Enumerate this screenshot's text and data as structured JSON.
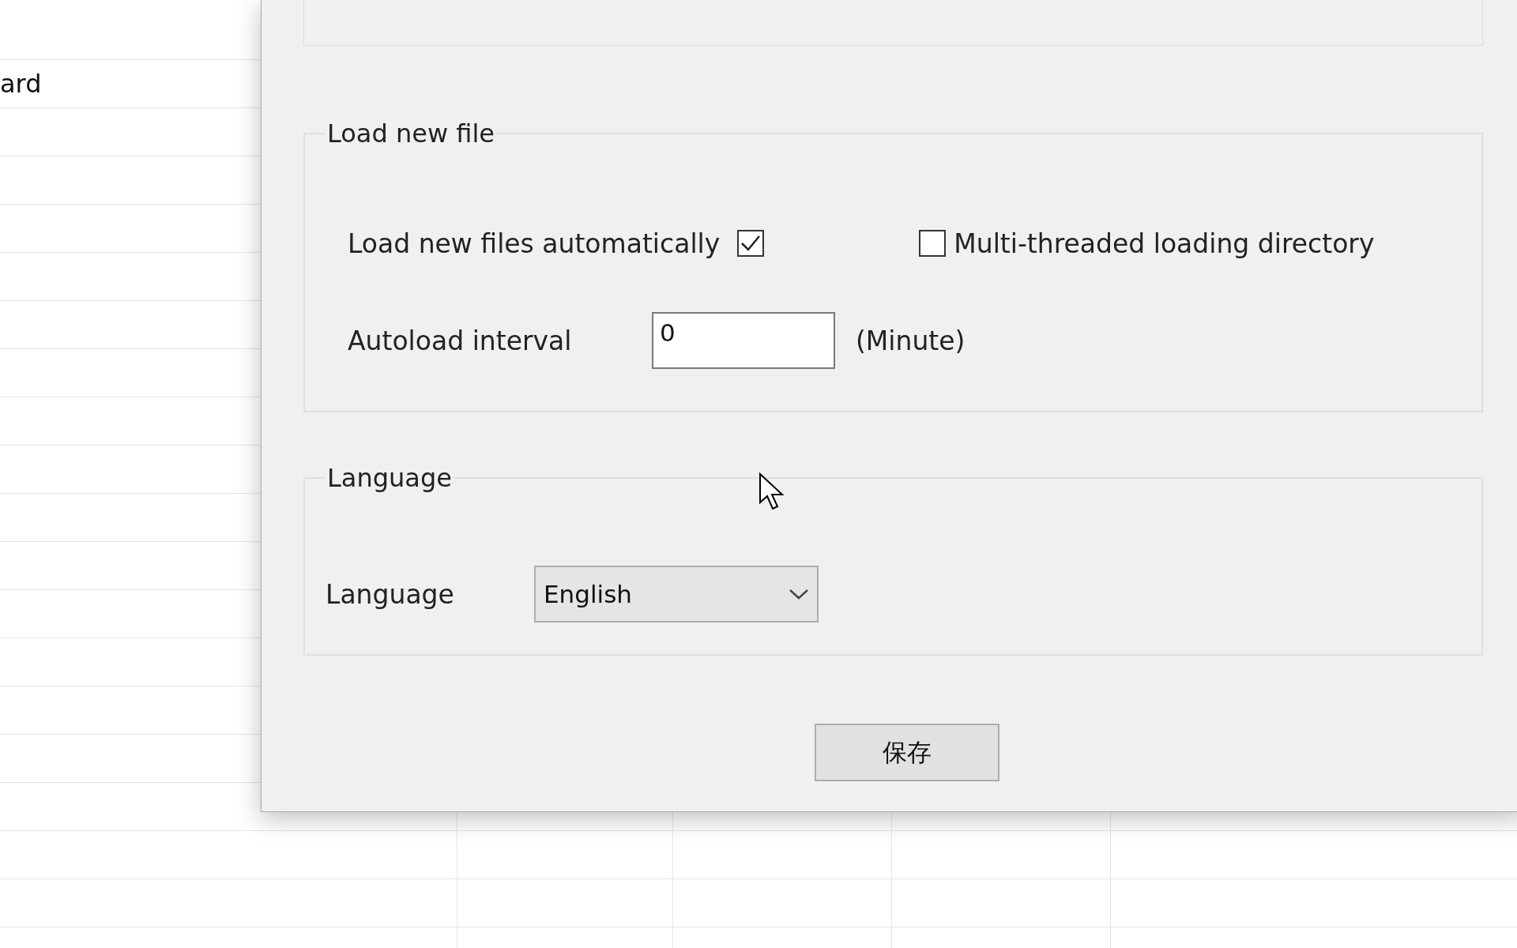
{
  "sheet": {
    "cell_text": "ard"
  },
  "dialog": {
    "load_group": {
      "title": "Load new file",
      "auto_load": {
        "label": "Load new files automatically",
        "checked": true
      },
      "multi_thread": {
        "label": "Multi-threaded loading directory",
        "checked": false
      },
      "interval": {
        "label": "Autoload interval",
        "value": "0",
        "unit": "(Minute)"
      }
    },
    "language_group": {
      "title": "Language",
      "label": "Language",
      "value": "English"
    },
    "save_button": "保存"
  }
}
